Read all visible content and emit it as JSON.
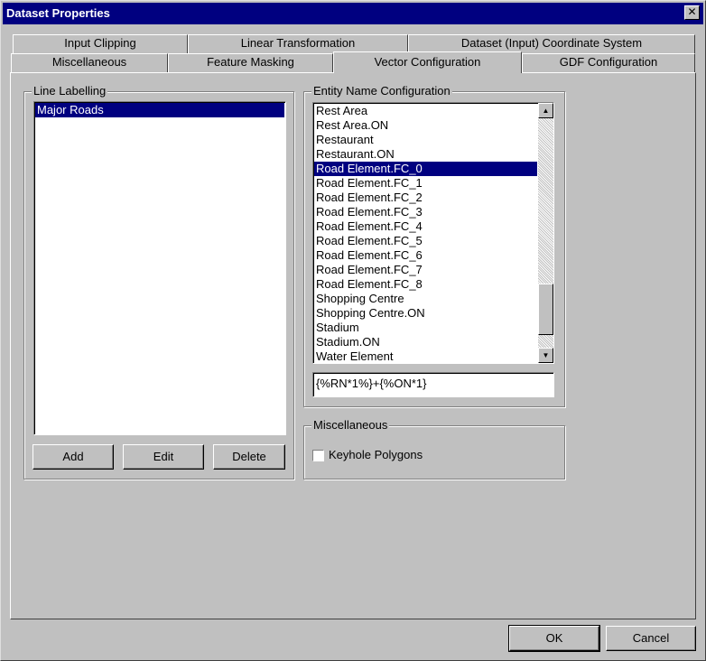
{
  "window": {
    "title": "Dataset Properties"
  },
  "tabs_back": [
    "Input Clipping",
    "Linear Transformation",
    "Dataset (Input) Coordinate System"
  ],
  "tabs_front": [
    "Miscellaneous",
    "Feature Masking",
    "Vector Configuration",
    "GDF Configuration"
  ],
  "active_tab": "Vector Configuration",
  "line_labelling": {
    "label": "Line Labelling",
    "items": [
      "Major Roads"
    ],
    "selected": "Major Roads",
    "buttons": {
      "add": "Add",
      "edit": "Edit",
      "delete": "Delete"
    }
  },
  "entity_name_configuration": {
    "label": "Entity Name Configuration",
    "items": [
      "Rest Area",
      "Rest Area.ON",
      "Restaurant",
      "Restaurant.ON",
      "Road Element.FC_0",
      "Road Element.FC_1",
      "Road Element.FC_2",
      "Road Element.FC_3",
      "Road Element.FC_4",
      "Road Element.FC_5",
      "Road Element.FC_6",
      "Road Element.FC_7",
      "Road Element.FC_8",
      "Shopping Centre",
      "Shopping Centre.ON",
      "Stadium",
      "Stadium.ON",
      "Water Element"
    ],
    "selected": "Road Element.FC_0",
    "expression_value": "{%RN*1%}+{%ON*1}"
  },
  "miscellaneous_group": {
    "label": "Miscellaneous",
    "keyhole_polygons": {
      "label": "Keyhole Polygons",
      "checked": false
    }
  },
  "footer": {
    "ok": "OK",
    "cancel": "Cancel"
  },
  "icons": {
    "close": "close-icon",
    "scroll_up": "scroll-up-icon",
    "scroll_down": "scroll-down-icon"
  },
  "colors": {
    "titlebar": "#000080",
    "selection": "#000080",
    "face": "#c0c0c0"
  }
}
